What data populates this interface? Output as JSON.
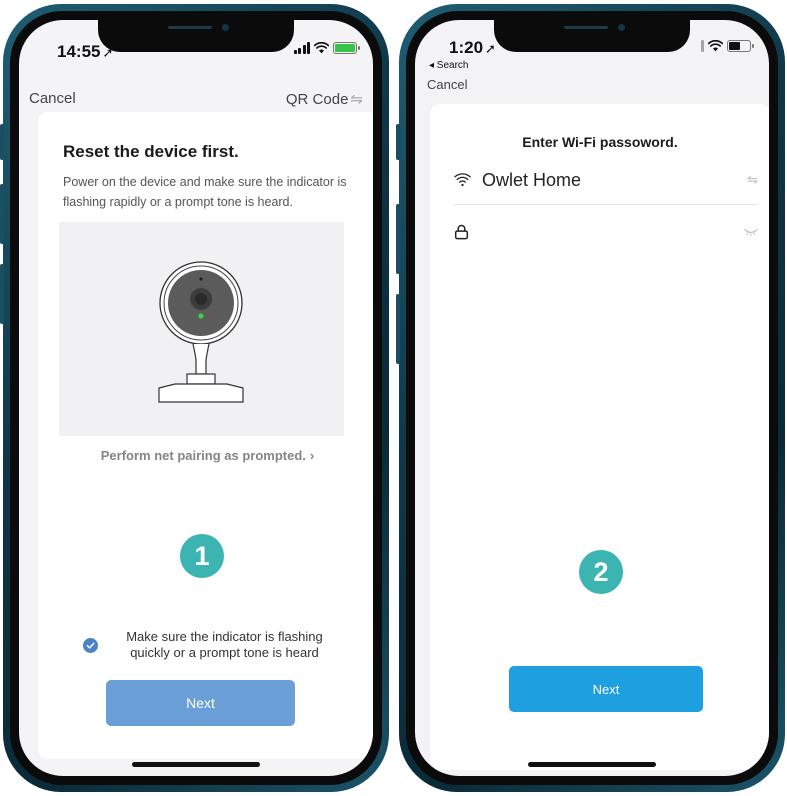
{
  "screen1": {
    "status": {
      "time": "14:55"
    },
    "nav": {
      "cancel": "Cancel",
      "qr_code": "QR Code",
      "qr_icon": "⇋"
    },
    "title": "Reset the device first.",
    "description": "Power on the device and make sure the indicator is flashing rapidly or a prompt tone is heard.",
    "pairing_link": "Perform net pairing as prompted.",
    "step_number": "1",
    "confirm_text": "Make sure the indicator is flashing quickly or a prompt tone is heard",
    "next_button": "Next"
  },
  "screen2": {
    "status": {
      "time": "1:20",
      "back_label": "◂ Search"
    },
    "nav": {
      "cancel": "Cancel"
    },
    "title": "Enter Wi-Fi passoword.",
    "wifi_name": "Owlet Home",
    "swap_icon": "⇋",
    "password_value": "",
    "step_number": "2",
    "next_button": "Next"
  },
  "colors": {
    "step_badge": "#3cb5b2",
    "next_button_1": "#6a9fd8",
    "next_button_2": "#1d9fe0",
    "check": "#4a83c9",
    "battery_charging": "#39c34a",
    "frame": "#0e3748"
  }
}
